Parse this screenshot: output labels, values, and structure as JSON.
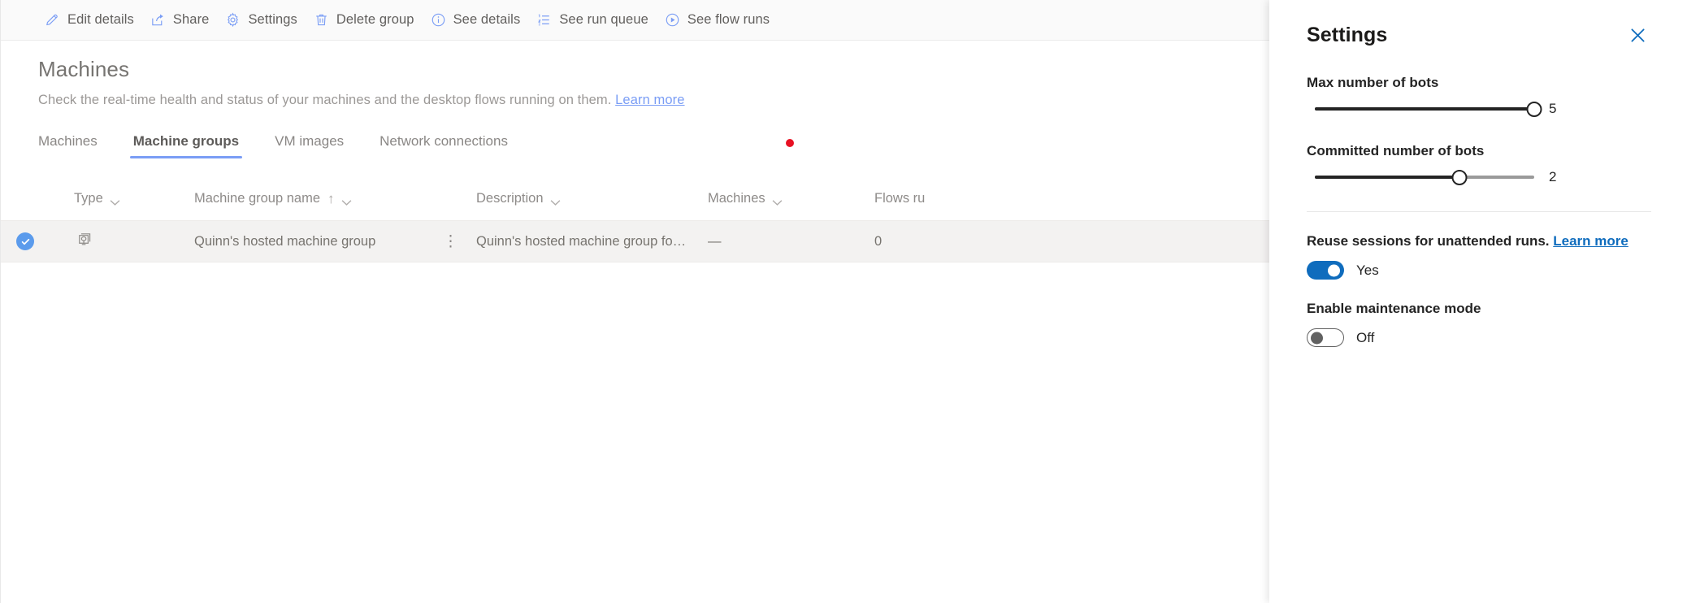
{
  "command_bar": {
    "items": [
      {
        "label": "Edit details",
        "icon": "pencil-icon"
      },
      {
        "label": "Share",
        "icon": "share-icon"
      },
      {
        "label": "Settings",
        "icon": "gear-icon"
      },
      {
        "label": "Delete group",
        "icon": "trash-icon"
      },
      {
        "label": "See details",
        "icon": "info-circle-icon"
      },
      {
        "label": "See run queue",
        "icon": "numbered-list-icon"
      },
      {
        "label": "See flow runs",
        "icon": "play-circle-icon"
      }
    ]
  },
  "page": {
    "title": "Machines",
    "subtitle": "Check the real-time health and status of your machines and the desktop flows running on them.",
    "learn_more": "Learn more"
  },
  "tabs": [
    {
      "label": "Machines",
      "active": false
    },
    {
      "label": "Machine groups",
      "active": true
    },
    {
      "label": "VM images",
      "active": false
    },
    {
      "label": "Network connections",
      "active": false
    }
  ],
  "table": {
    "columns": [
      {
        "label": "Type",
        "sorted": false
      },
      {
        "label": "Machine group name",
        "sorted": true,
        "sort_direction": "↑"
      },
      {
        "label": "Description",
        "sorted": false
      },
      {
        "label": "Machines",
        "sorted": false
      },
      {
        "label": "Flows ru",
        "sorted": false
      }
    ],
    "rows": [
      {
        "selected": true,
        "type_icon": "machine-group-icon",
        "name": "Quinn's hosted machine group",
        "description": "Quinn's hosted machine group for Financ...",
        "machines": "—",
        "flows_running": "0",
        "overflow_menu": "⋮"
      }
    ]
  },
  "settings_panel": {
    "title": "Settings",
    "close_icon": "close-icon",
    "max_bots": {
      "label": "Max number of bots",
      "value": "5",
      "percent": 100
    },
    "committed_bots": {
      "label": "Committed number of bots",
      "value": "2",
      "percent": 66
    },
    "reuse_sessions": {
      "label": "Reuse sessions for unattended runs.",
      "link": "Learn more",
      "state": "Yes",
      "on": true
    },
    "maintenance_mode": {
      "label": "Enable maintenance mode",
      "state": "Off",
      "on": false
    }
  },
  "colors": {
    "accent_blue": "#0f6cbd",
    "toolbar_icon_blue": "#7a9df5",
    "tab_underline": "#7a9df5",
    "alert_dot_red": "#e81123",
    "row_selected_bg": "#f3f2f1"
  }
}
